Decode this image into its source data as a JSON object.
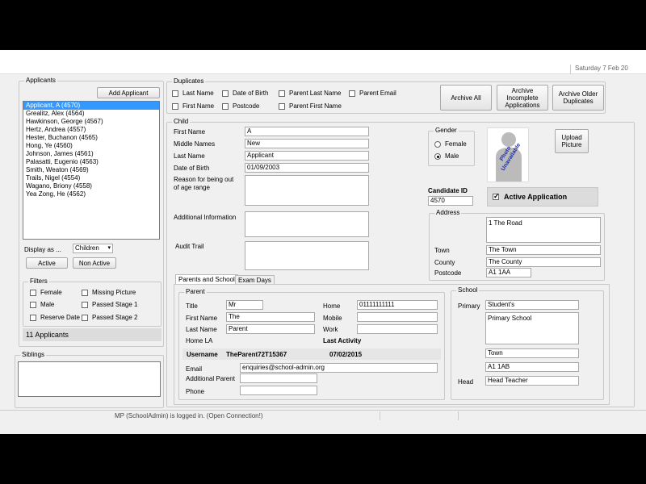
{
  "status_date": "Saturday  7 Feb 20",
  "applicants": {
    "group_label": "Applicants",
    "add_button": "Add Applicant",
    "items": [
      "Applicant, A (4570)",
      "Grealitz, Alex (4564)",
      "Hawkinson, George (4567)",
      "Hertz, Andrea (4557)",
      "Hester, Buchanon (4565)",
      "Hong, Ye (4560)",
      "Johnson, James (4561)",
      "Palasatti, Eugenio (4563)",
      "Smith, Weaton (4569)",
      "Trails, Nigel (4554)",
      "Wagano, Briony (4558)",
      "Yea Zong, He (4562)"
    ],
    "selected_index": 0,
    "display_as_label": "Display as ...",
    "display_as_value": "Children",
    "active_button": "Active",
    "non_active_button": "Non Active",
    "count_text": "11 Applicants"
  },
  "filters": {
    "label": "Filters",
    "items": [
      "Female",
      "Missing Picture",
      "Male",
      "Passed Stage 1",
      "Reserve Date",
      "Passed Stage 2"
    ]
  },
  "siblings": {
    "label": "Siblings"
  },
  "duplicates": {
    "label": "Duplicates",
    "checks": [
      "Last Name",
      "Date of Birth",
      "Parent Last Name",
      "Parent Email",
      "First Name",
      "Postcode",
      "Parent First Name"
    ],
    "archive_all": "Archive All",
    "archive_incomplete": "Archive\nIncomplete\nApplications",
    "archive_older": "Archive Older\nDuplicates"
  },
  "child": {
    "label": "Child",
    "first_name_label": "First Name",
    "first_name": "A",
    "middle_names_label": "Middle Names",
    "middle_names": "New",
    "last_name_label": "Last Name",
    "last_name": "Applicant",
    "dob_label": "Date of Birth",
    "dob": "01/09/2003",
    "reason_label": "Reason for being out of age range",
    "additional_info_label": "Additional Information",
    "audit_trail_label": "Audit Trail",
    "gender_label": "Gender",
    "female": "Female",
    "male": "Male",
    "gender_selected": "Male",
    "photo_text": "Photo\nUnavailable",
    "upload_button": "Upload\nPicture",
    "candidate_id_label": "Candidate ID",
    "candidate_id": "4570",
    "active_application_label": "Active Application",
    "active_application": true
  },
  "address": {
    "label": "Address",
    "line1": "1 The Road",
    "town_label": "Town",
    "town": "The Town",
    "county_label": "County",
    "county": "The County",
    "postcode_label": "Postcode",
    "postcode": "A1 1AA"
  },
  "tabs": [
    "Parents and School",
    "Exam Days"
  ],
  "parent": {
    "label": "Parent",
    "title_label": "Title",
    "title": "Mr",
    "first_name_label": "First Name",
    "first_name": "The",
    "last_name_label": "Last Name",
    "last_name": "Parent",
    "home_la_label": "Home LA",
    "home_label": "Home",
    "home": "01111111111",
    "mobile_label": "Mobile",
    "work_label": "Work",
    "last_activity_label": "Last Activity",
    "username_label": "Username",
    "username": "TheParent72T15367",
    "last_activity": "07/02/2015",
    "email_label": "Email",
    "email": "enquiries@school-admin.org",
    "additional_parent_label": "Additional Parent",
    "phone_label": "Phone"
  },
  "school": {
    "label": "School",
    "primary_label": "Primary",
    "primary": "Student's",
    "primary_school": "Primary School",
    "town": "Town",
    "postcode": "A1 1AB",
    "head_label": "Head",
    "head": "Head Teacher"
  },
  "status_bar": "MP (SchoolAdmin) is logged in. (Open Connection!)"
}
